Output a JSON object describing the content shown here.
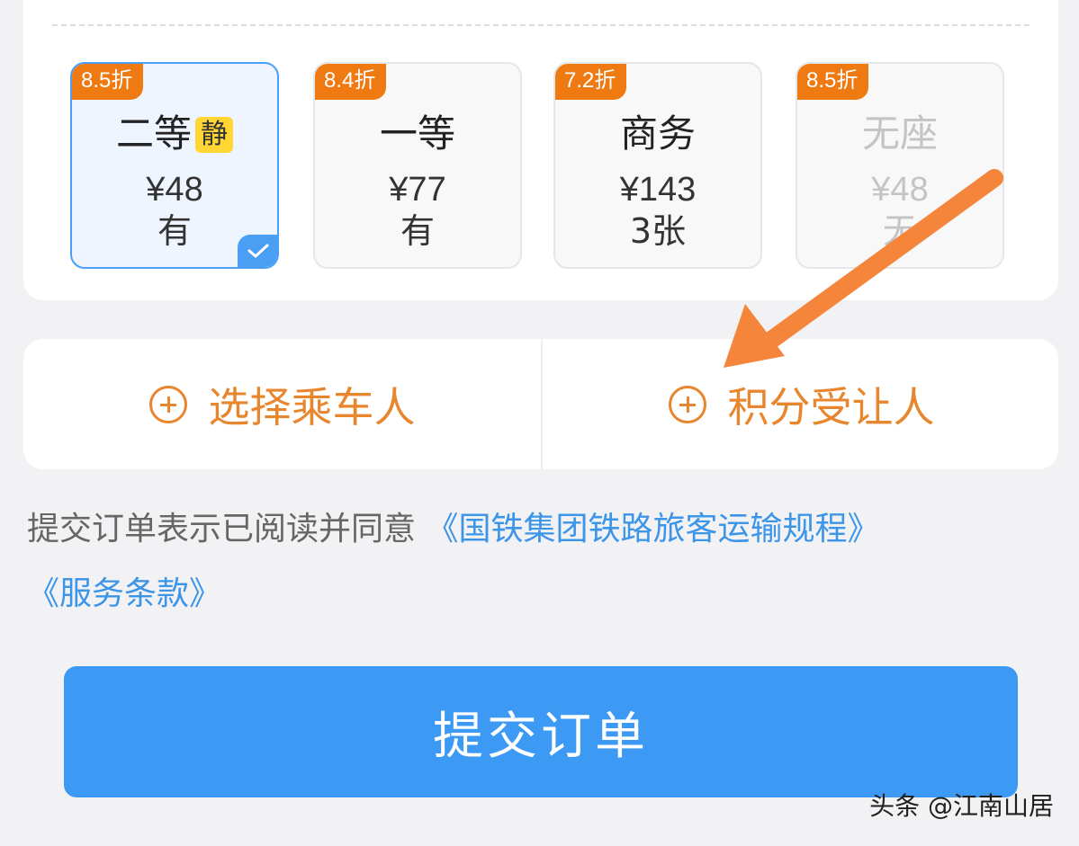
{
  "seats": [
    {
      "discount": "8.5折",
      "name": "二等",
      "tag": "静",
      "price": "¥48",
      "availability": "有",
      "selected": true
    },
    {
      "discount": "8.4折",
      "name": "一等",
      "tag": "",
      "price": "¥77",
      "availability": "有",
      "selected": false
    },
    {
      "discount": "7.2折",
      "name": "商务",
      "tag": "",
      "price": "¥143",
      "availability": "3张",
      "selected": false
    },
    {
      "discount": "8.5折",
      "name": "无座",
      "tag": "",
      "price": "¥48",
      "availability": "无",
      "selected": false
    }
  ],
  "actions": {
    "select_passenger": "选择乘车人",
    "points_beneficiary": "积分受让人"
  },
  "agreement": {
    "prefix": "提交订单表示已阅读并同意",
    "link_rules": "《国铁集团铁路旅客运输规程》",
    "link_terms": "《服务条款》"
  },
  "submit_label": "提交订单",
  "watermark": "头条 @江南山居",
  "colors": {
    "accent": "#3c9af4",
    "orange": "#e8862e",
    "discount": "#f07a12",
    "quiet_tag": "#ffd633",
    "annotation_arrow": "#f5853a"
  }
}
